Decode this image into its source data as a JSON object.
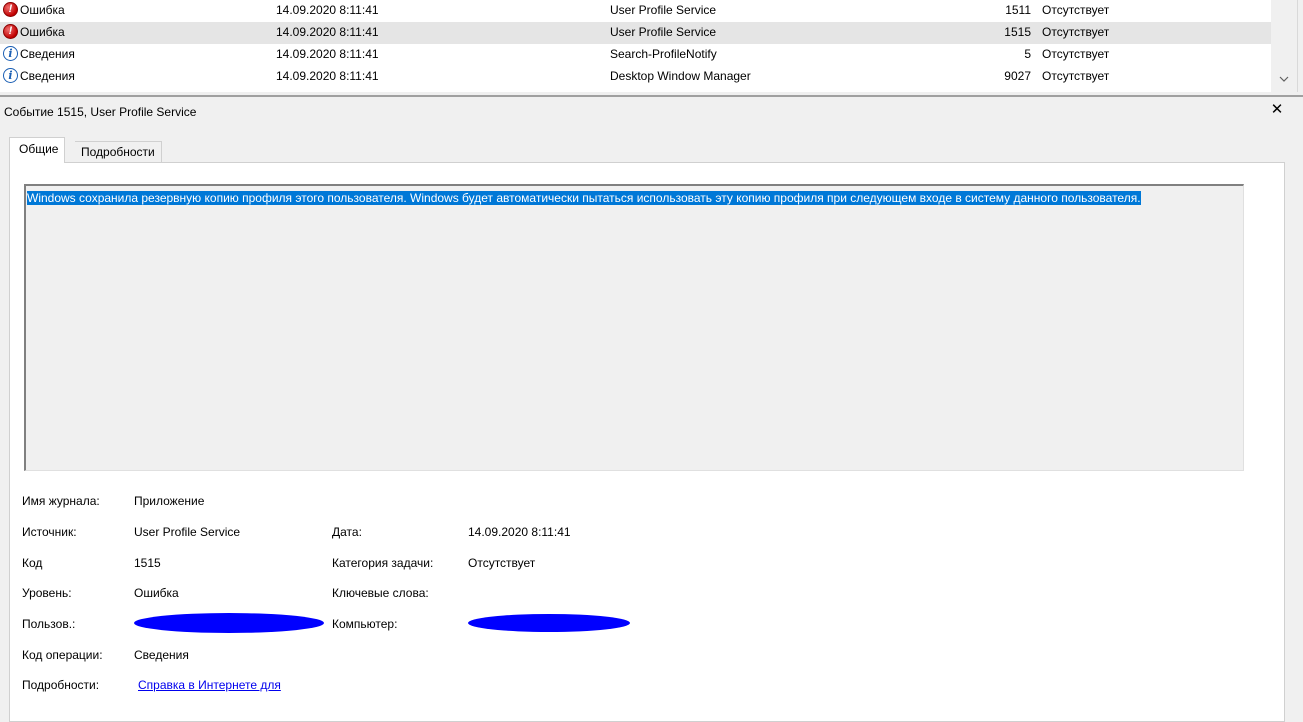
{
  "events": [
    {
      "level": "Ошибка",
      "type": "error",
      "date": "14.09.2020 8:11:41",
      "source": "User Profile Service",
      "code": "1511",
      "category": "Отсутствует"
    },
    {
      "level": "Ошибка",
      "type": "error",
      "date": "14.09.2020 8:11:41",
      "source": "User Profile Service",
      "code": "1515",
      "category": "Отсутствует"
    },
    {
      "level": "Сведения",
      "type": "info",
      "date": "14.09.2020 8:11:41",
      "source": "Search-ProfileNotify",
      "code": "5",
      "category": "Отсутствует"
    },
    {
      "level": "Сведения",
      "type": "info",
      "date": "14.09.2020 8:11:41",
      "source": "Desktop Window Manager",
      "code": "9027",
      "category": "Отсутствует"
    }
  ],
  "details": {
    "title": "Событие 1515, User Profile Service",
    "tabs": {
      "general": "Общие",
      "details": "Подробности"
    },
    "description": "Windows сохранила резервную копию профиля этого пользователя. Windows будет автоматически пытаться использовать эту копию профиля при следующем входе в систему данного пользователя.",
    "labels": {
      "log_name": "Имя журнала:",
      "source": "Источник:",
      "date": "Дата:",
      "code": "Код",
      "task_category": "Категория задачи:",
      "level": "Уровень:",
      "keywords": "Ключевые слова:",
      "user": "Пользов.:",
      "computer": "Компьютер:",
      "opcode": "Код операции:",
      "more_info": "Подробности:"
    },
    "values": {
      "log_name": "Приложение",
      "source": "User Profile Service",
      "date": "14.09.2020 8:11:41",
      "code": "1515",
      "task_category": "Отсутствует",
      "level": "Ошибка",
      "keywords": "",
      "opcode": "Сведения",
      "more_info_link": "Справка в Интернете для"
    }
  },
  "colors": {
    "selection": "#0078d7",
    "redaction": "#0000ff",
    "error_icon": "#c10000",
    "info_icon": "#1b5fb4"
  },
  "icons": {
    "error": "error-icon",
    "info": "info-icon",
    "close": "close-icon",
    "scroll_down": "chevron-down-icon"
  }
}
